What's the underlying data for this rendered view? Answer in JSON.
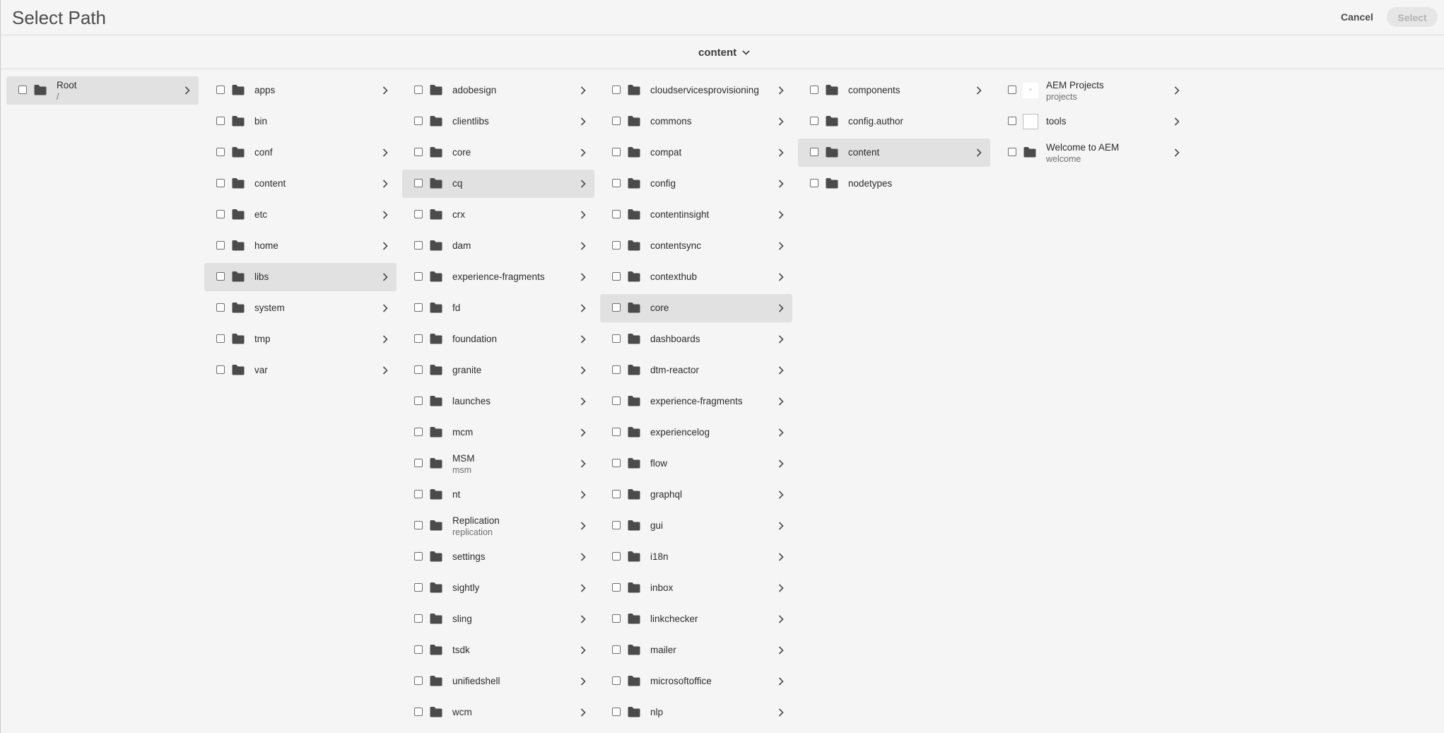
{
  "header": {
    "title": "Select Path",
    "cancel_label": "Cancel",
    "select_label": "Select"
  },
  "path_selector": {
    "current": "content",
    "icon": "chevron-down-icon"
  },
  "columns": [
    {
      "items": [
        {
          "label": "Root",
          "sub": "/",
          "icon": "folder-icon",
          "chevron": true,
          "selected": true
        }
      ]
    },
    {
      "items": [
        {
          "label": "apps",
          "icon": "folder-icon",
          "chevron": true
        },
        {
          "label": "bin",
          "icon": "folder-icon",
          "chevron": false
        },
        {
          "label": "conf",
          "icon": "folder-icon",
          "chevron": true
        },
        {
          "label": "content",
          "icon": "folder-icon",
          "chevron": true
        },
        {
          "label": "etc",
          "icon": "folder-icon",
          "chevron": true
        },
        {
          "label": "home",
          "icon": "folder-icon",
          "chevron": true
        },
        {
          "label": "libs",
          "icon": "folder-icon",
          "chevron": true,
          "selected": true
        },
        {
          "label": "system",
          "icon": "folder-icon",
          "chevron": true
        },
        {
          "label": "tmp",
          "icon": "folder-icon",
          "chevron": true
        },
        {
          "label": "var",
          "icon": "folder-icon",
          "chevron": true
        }
      ]
    },
    {
      "items": [
        {
          "label": "adobesign",
          "icon": "folder-icon",
          "chevron": true
        },
        {
          "label": "clientlibs",
          "icon": "folder-icon",
          "chevron": true
        },
        {
          "label": "core",
          "icon": "folder-icon",
          "chevron": true
        },
        {
          "label": "cq",
          "icon": "folder-icon",
          "chevron": true,
          "selected": true
        },
        {
          "label": "crx",
          "icon": "folder-icon",
          "chevron": true
        },
        {
          "label": "dam",
          "icon": "folder-icon",
          "chevron": true
        },
        {
          "label": "experience-fragments",
          "icon": "folder-icon",
          "chevron": true
        },
        {
          "label": "fd",
          "icon": "folder-icon",
          "chevron": true
        },
        {
          "label": "foundation",
          "icon": "folder-icon",
          "chevron": true
        },
        {
          "label": "granite",
          "icon": "folder-icon",
          "chevron": true
        },
        {
          "label": "launches",
          "icon": "folder-icon",
          "chevron": true
        },
        {
          "label": "mcm",
          "icon": "folder-icon",
          "chevron": true
        },
        {
          "label": "MSM",
          "sub": "msm",
          "icon": "folder-icon",
          "chevron": true
        },
        {
          "label": "nt",
          "icon": "folder-icon",
          "chevron": true
        },
        {
          "label": "Replication",
          "sub": "replication",
          "icon": "folder-icon",
          "chevron": true
        },
        {
          "label": "settings",
          "icon": "folder-icon",
          "chevron": true
        },
        {
          "label": "sightly",
          "icon": "folder-icon",
          "chevron": true
        },
        {
          "label": "sling",
          "icon": "folder-icon",
          "chevron": true
        },
        {
          "label": "tsdk",
          "icon": "folder-icon",
          "chevron": true
        },
        {
          "label": "unifiedshell",
          "icon": "folder-icon",
          "chevron": true
        },
        {
          "label": "wcm",
          "icon": "folder-icon",
          "chevron": true
        }
      ]
    },
    {
      "items": [
        {
          "label": "cloudservicesprovisioning",
          "icon": "folder-icon",
          "chevron": true
        },
        {
          "label": "commons",
          "icon": "folder-icon",
          "chevron": true
        },
        {
          "label": "compat",
          "icon": "folder-icon",
          "chevron": true
        },
        {
          "label": "config",
          "icon": "folder-icon",
          "chevron": true
        },
        {
          "label": "contentinsight",
          "icon": "folder-icon",
          "chevron": true
        },
        {
          "label": "contentsync",
          "icon": "folder-icon",
          "chevron": true
        },
        {
          "label": "contexthub",
          "icon": "folder-icon",
          "chevron": true
        },
        {
          "label": "core",
          "icon": "folder-icon",
          "chevron": true,
          "selected": true
        },
        {
          "label": "dashboards",
          "icon": "folder-icon",
          "chevron": true
        },
        {
          "label": "dtm-reactor",
          "icon": "folder-icon",
          "chevron": true
        },
        {
          "label": "experience-fragments",
          "icon": "folder-icon",
          "chevron": true
        },
        {
          "label": "experiencelog",
          "icon": "folder-icon",
          "chevron": true
        },
        {
          "label": "flow",
          "icon": "folder-icon",
          "chevron": true
        },
        {
          "label": "graphql",
          "icon": "folder-icon",
          "chevron": true
        },
        {
          "label": "gui",
          "icon": "folder-icon",
          "chevron": true
        },
        {
          "label": "i18n",
          "icon": "folder-icon",
          "chevron": true
        },
        {
          "label": "inbox",
          "icon": "folder-icon",
          "chevron": true
        },
        {
          "label": "linkchecker",
          "icon": "folder-icon",
          "chevron": true
        },
        {
          "label": "mailer",
          "icon": "folder-icon",
          "chevron": true
        },
        {
          "label": "microsoftoffice",
          "icon": "folder-icon",
          "chevron": true
        },
        {
          "label": "nlp",
          "icon": "folder-icon",
          "chevron": true
        }
      ]
    },
    {
      "items": [
        {
          "label": "components",
          "icon": "folder-icon",
          "chevron": true
        },
        {
          "label": "config.author",
          "icon": "folder-icon",
          "chevron": false
        },
        {
          "label": "content",
          "icon": "folder-icon",
          "chevron": true,
          "selected": true
        },
        {
          "label": "nodetypes",
          "icon": "folder-icon",
          "chevron": false
        }
      ]
    },
    {
      "items": [
        {
          "label": "AEM Projects",
          "sub": "projects",
          "icon": "page-thumbnail-icon",
          "chevron": true
        },
        {
          "label": "tools",
          "icon": "blank-thumbnail-icon",
          "chevron": true
        },
        {
          "label": "Welcome to AEM",
          "sub": "welcome",
          "icon": "folder-icon",
          "chevron": true
        }
      ]
    }
  ]
}
